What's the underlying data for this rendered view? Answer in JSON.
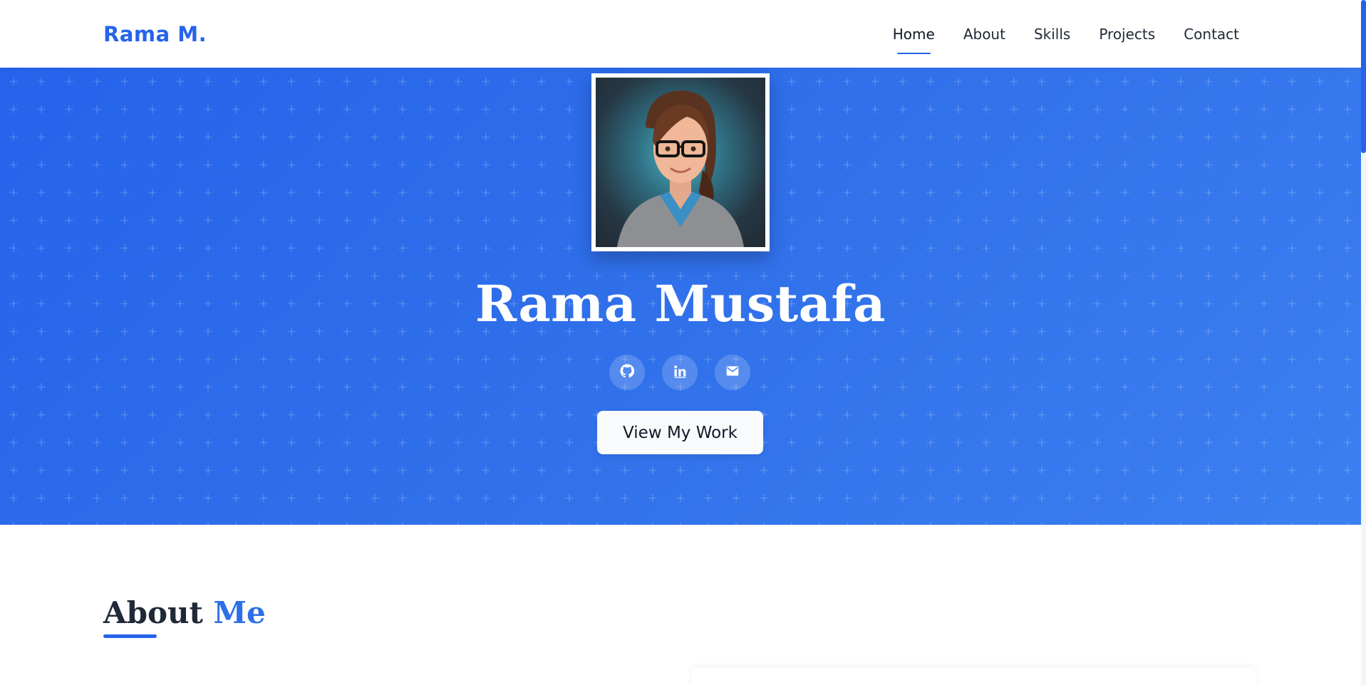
{
  "brand": "Rama M.",
  "nav": {
    "items": [
      {
        "label": "Home",
        "active": true
      },
      {
        "label": "About",
        "active": false
      },
      {
        "label": "Skills",
        "active": false
      },
      {
        "label": "Projects",
        "active": false
      },
      {
        "label": "Contact",
        "active": false
      }
    ]
  },
  "hero": {
    "name": "Rama Mustafa",
    "avatar_alt": "avatar",
    "social": [
      {
        "icon": "github-icon"
      },
      {
        "icon": "linkedin-icon"
      },
      {
        "icon": "envelope-icon"
      }
    ],
    "cta_label": "View My Work"
  },
  "about": {
    "title_main": "About",
    "title_accent": "Me"
  },
  "colors": {
    "brand": "#2563eb",
    "hero_start": "#2563eb",
    "hero_end": "#3b7ff0",
    "accent": "#2d6fe8"
  }
}
